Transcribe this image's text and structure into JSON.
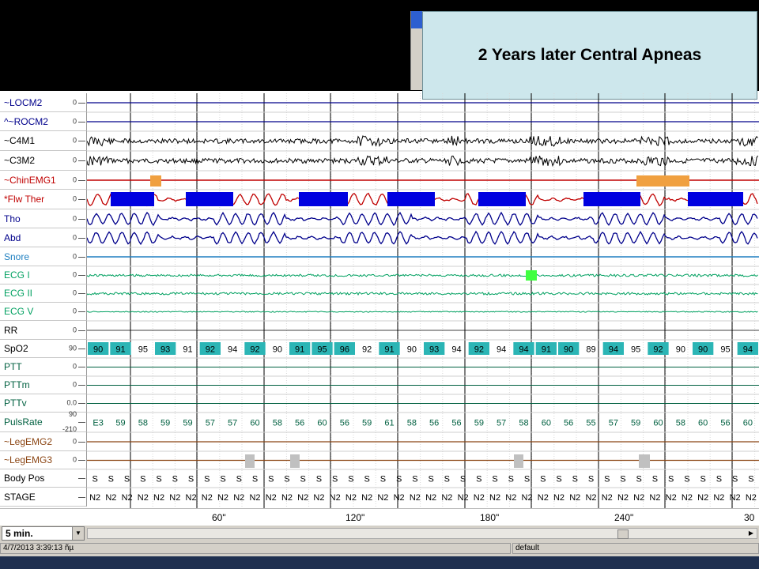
{
  "slide_title": "2 Years later Central Apneas",
  "channels": [
    {
      "name": "~LOCM2",
      "color": "#00008b",
      "zero": "0"
    },
    {
      "name": "^~ROCM2",
      "color": "#00008b",
      "zero": "0"
    },
    {
      "name": "~C4M1",
      "color": "#000000",
      "zero": "0"
    },
    {
      "name": "~C3M2",
      "color": "#000000",
      "zero": "0"
    },
    {
      "name": "~ChinEMG1",
      "color": "#c00000",
      "zero": "0"
    },
    {
      "name": "*Flw Ther",
      "color": "#c00000",
      "zero": "0"
    },
    {
      "name": "Tho",
      "color": "#00008b",
      "zero": "0"
    },
    {
      "name": "Abd",
      "color": "#00008b",
      "zero": "0"
    },
    {
      "name": "Snore",
      "color": "#1e7fc0",
      "zero": "0"
    },
    {
      "name": "ECG I",
      "color": "#00a060",
      "zero": "0"
    },
    {
      "name": "ECG II",
      "color": "#00a060",
      "zero": "0"
    },
    {
      "name": "ECG V",
      "color": "#00a060",
      "zero": "0"
    },
    {
      "name": "RR",
      "color": "#000000",
      "zero": "0"
    },
    {
      "name": "SpO2",
      "color": "#000000",
      "zero": "90"
    },
    {
      "name": "PTT",
      "color": "#006040",
      "zero": "0"
    },
    {
      "name": "PTTm",
      "color": "#006040",
      "zero": "0"
    },
    {
      "name": "PTTv",
      "color": "#006040",
      "zero": "0.0"
    },
    {
      "name": "PulsRate",
      "color": "#006040",
      "zero": "",
      "scale_top": "90",
      "scale_bottom": "-210"
    },
    {
      "name": "~LegEMG2",
      "color": "#8b4513",
      "zero": "0"
    },
    {
      "name": "~LegEMG3",
      "color": "#8b4513",
      "zero": "0"
    },
    {
      "name": "Body Pos",
      "color": "#000000",
      "zero": ""
    },
    {
      "name": "STAGE",
      "color": "#000000",
      "zero": ""
    }
  ],
  "spo2_values": [
    "90",
    "91",
    "95",
    "93",
    "91",
    "92",
    "94",
    "92",
    "90",
    "91",
    "95",
    "96",
    "92",
    "91",
    "90",
    "93",
    "94",
    "92",
    "94",
    "94",
    "91",
    "90",
    "89",
    "94",
    "95",
    "92",
    "90",
    "90",
    "95",
    "94"
  ],
  "pulse_values": [
    "E3",
    "59",
    "58",
    "59",
    "59",
    "57",
    "57",
    "60",
    "58",
    "56",
    "60",
    "56",
    "59",
    "61",
    "58",
    "56",
    "56",
    "59",
    "57",
    "58",
    "60",
    "56",
    "55",
    "57",
    "59",
    "60",
    "58",
    "60",
    "56",
    "60"
  ],
  "body_pos_value": "S",
  "stage_value": "N2",
  "time_axis": [
    "60\"",
    "120\"",
    "180\"",
    "240\"",
    "30"
  ],
  "zoom_select": "5 min.",
  "status_time": "4/7/2013 3:39:13 ñµ",
  "status_profile": "default"
}
